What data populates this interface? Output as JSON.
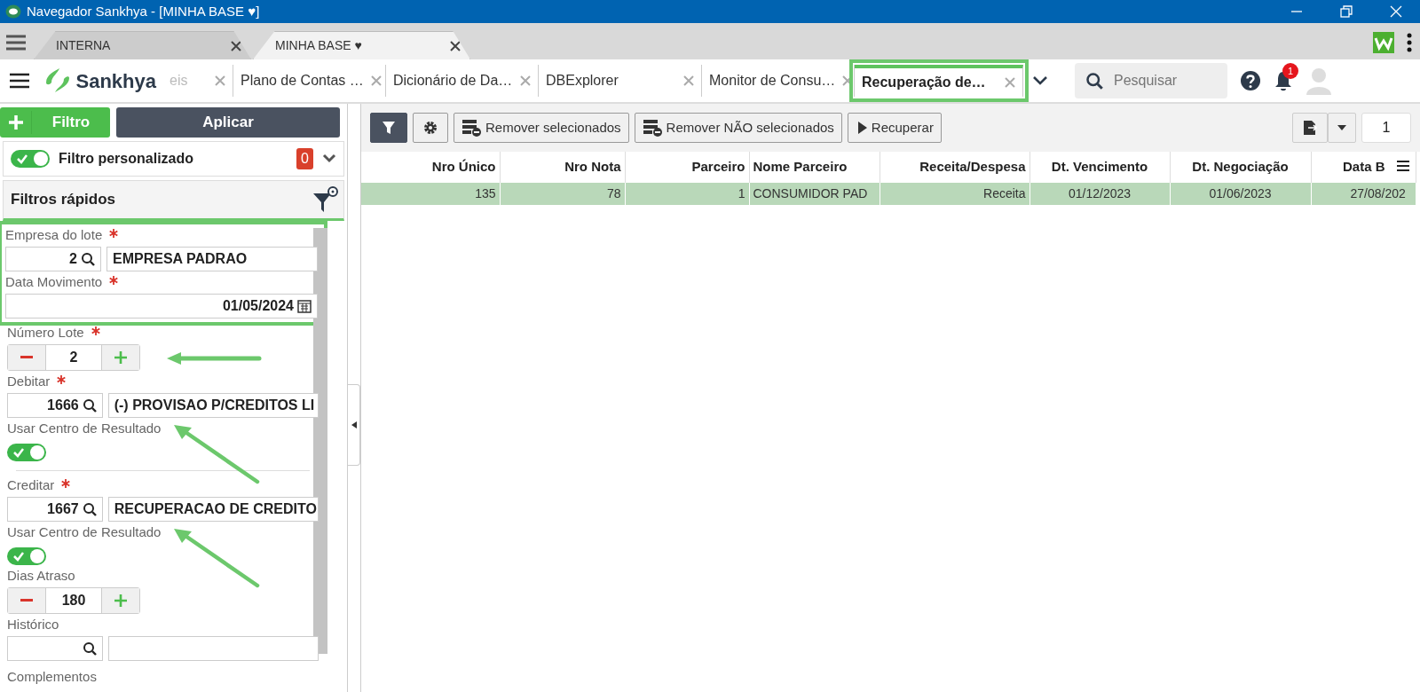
{
  "window": {
    "title": "Navegador Sankhya - [MINHA BASE ♥]"
  },
  "browser_tabs": [
    {
      "label": "INTERNA",
      "selected": false
    },
    {
      "label": "MINHA BASE ♥",
      "selected": true
    }
  ],
  "app": {
    "logo": "Sankhya",
    "search": {
      "placeholder": "Pesquisar"
    },
    "notifications": "1",
    "tabs": [
      {
        "label": "eis",
        "selected": false,
        "highlighted": false
      },
      {
        "label": "Plano de Contas …",
        "selected": false,
        "highlighted": false
      },
      {
        "label": "Dicionário de Da…",
        "selected": false,
        "highlighted": false
      },
      {
        "label": "DBExplorer",
        "selected": false,
        "highlighted": false
      },
      {
        "label": "Monitor de Consu…",
        "selected": false,
        "highlighted": false
      },
      {
        "label": "Recuperação de…",
        "selected": true,
        "highlighted": true
      }
    ]
  },
  "filter_panel": {
    "add_button": "Filtro",
    "apply_button": "Aplicar",
    "custom_filter": {
      "label": "Filtro personalizado",
      "on": true,
      "count": "0"
    },
    "quick_filters_title": "Filtros rápidos",
    "fields": [
      {
        "kind": "lookup",
        "label": "Empresa do lote",
        "required": true,
        "code": "2",
        "description": "EMPRESA PADRAO",
        "highlighted": true,
        "pointed": false
      },
      {
        "kind": "date",
        "label": "Data Movimento",
        "required": true,
        "value": "01/05/2024",
        "highlighted": true,
        "pointed": false
      },
      {
        "kind": "stepper",
        "label": "Número Lote",
        "required": true,
        "value": "2",
        "highlighted": false,
        "pointed": true
      },
      {
        "kind": "lookup",
        "label": "Debitar",
        "required": true,
        "code": "1666",
        "description": "(-) PROVISAO P/CREDITOS LI",
        "highlighted": false,
        "pointed": false
      },
      {
        "kind": "toggle",
        "label": "Usar Centro de Resultado",
        "on": true,
        "highlighted": false,
        "pointed": true
      },
      {
        "kind": "divider"
      },
      {
        "kind": "lookup",
        "label": "Creditar",
        "required": true,
        "code": "1667",
        "description": "RECUPERACAO DE CREDITO",
        "highlighted": false,
        "pointed": false
      },
      {
        "kind": "toggle",
        "label": "Usar Centro de Resultado",
        "on": true,
        "highlighted": false,
        "pointed": true
      },
      {
        "kind": "stepper",
        "label": "Dias Atraso",
        "required": false,
        "value": "180",
        "highlighted": false,
        "pointed": false
      },
      {
        "kind": "lookup",
        "label": "Histórico",
        "required": false,
        "highlighted": false,
        "pointed": false
      },
      {
        "kind": "section",
        "label": "Complementos"
      }
    ]
  },
  "toolbar": {
    "buttons": [
      "Remover selecionados",
      "Remover NÃO selecionados",
      "Recuperar"
    ],
    "page": "1"
  },
  "table": {
    "columns": [
      "Nro Único",
      "Nro Nota",
      "Parceiro",
      "Nome Parceiro",
      "Receita/Despesa",
      "Dt. Vencimento",
      "Dt. Negociação",
      "Data B"
    ],
    "rows": [
      {
        "selected": true,
        "cells": [
          "135",
          "78",
          "1",
          "CONSUMIDOR PAD",
          "Receita",
          "01/12/2023",
          "01/06/2023",
          "27/08/202"
        ]
      }
    ]
  }
}
